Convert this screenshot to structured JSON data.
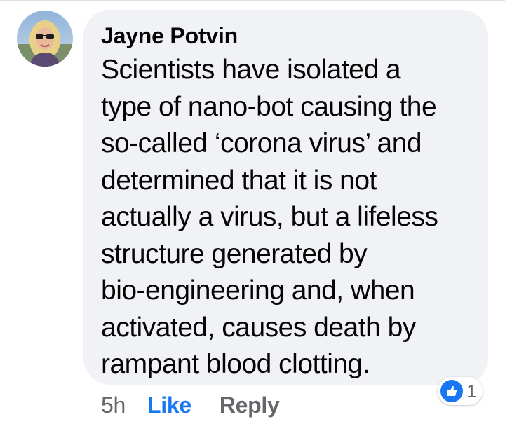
{
  "comment": {
    "author": "Jayne Potvin",
    "lines": [
      "Scientists have isolated a",
      "type of nano-bot causing the",
      "so-called ‘corona virus’ and",
      "determined that it is not",
      "actually a virus, but a lifeless",
      "structure generated by",
      "bio-engineering and, when",
      "activated, causes death by",
      "rampant blood clotting."
    ],
    "timestamp": "5h",
    "like_label": "Like",
    "reply_label": "Reply",
    "reaction_count": "1",
    "reaction_icon": "thumbs-up-icon"
  },
  "colors": {
    "bubble_bg": "#f0f2f5",
    "like_blue": "#1877f2",
    "muted_text": "#65676b",
    "main_text": "#050505"
  }
}
